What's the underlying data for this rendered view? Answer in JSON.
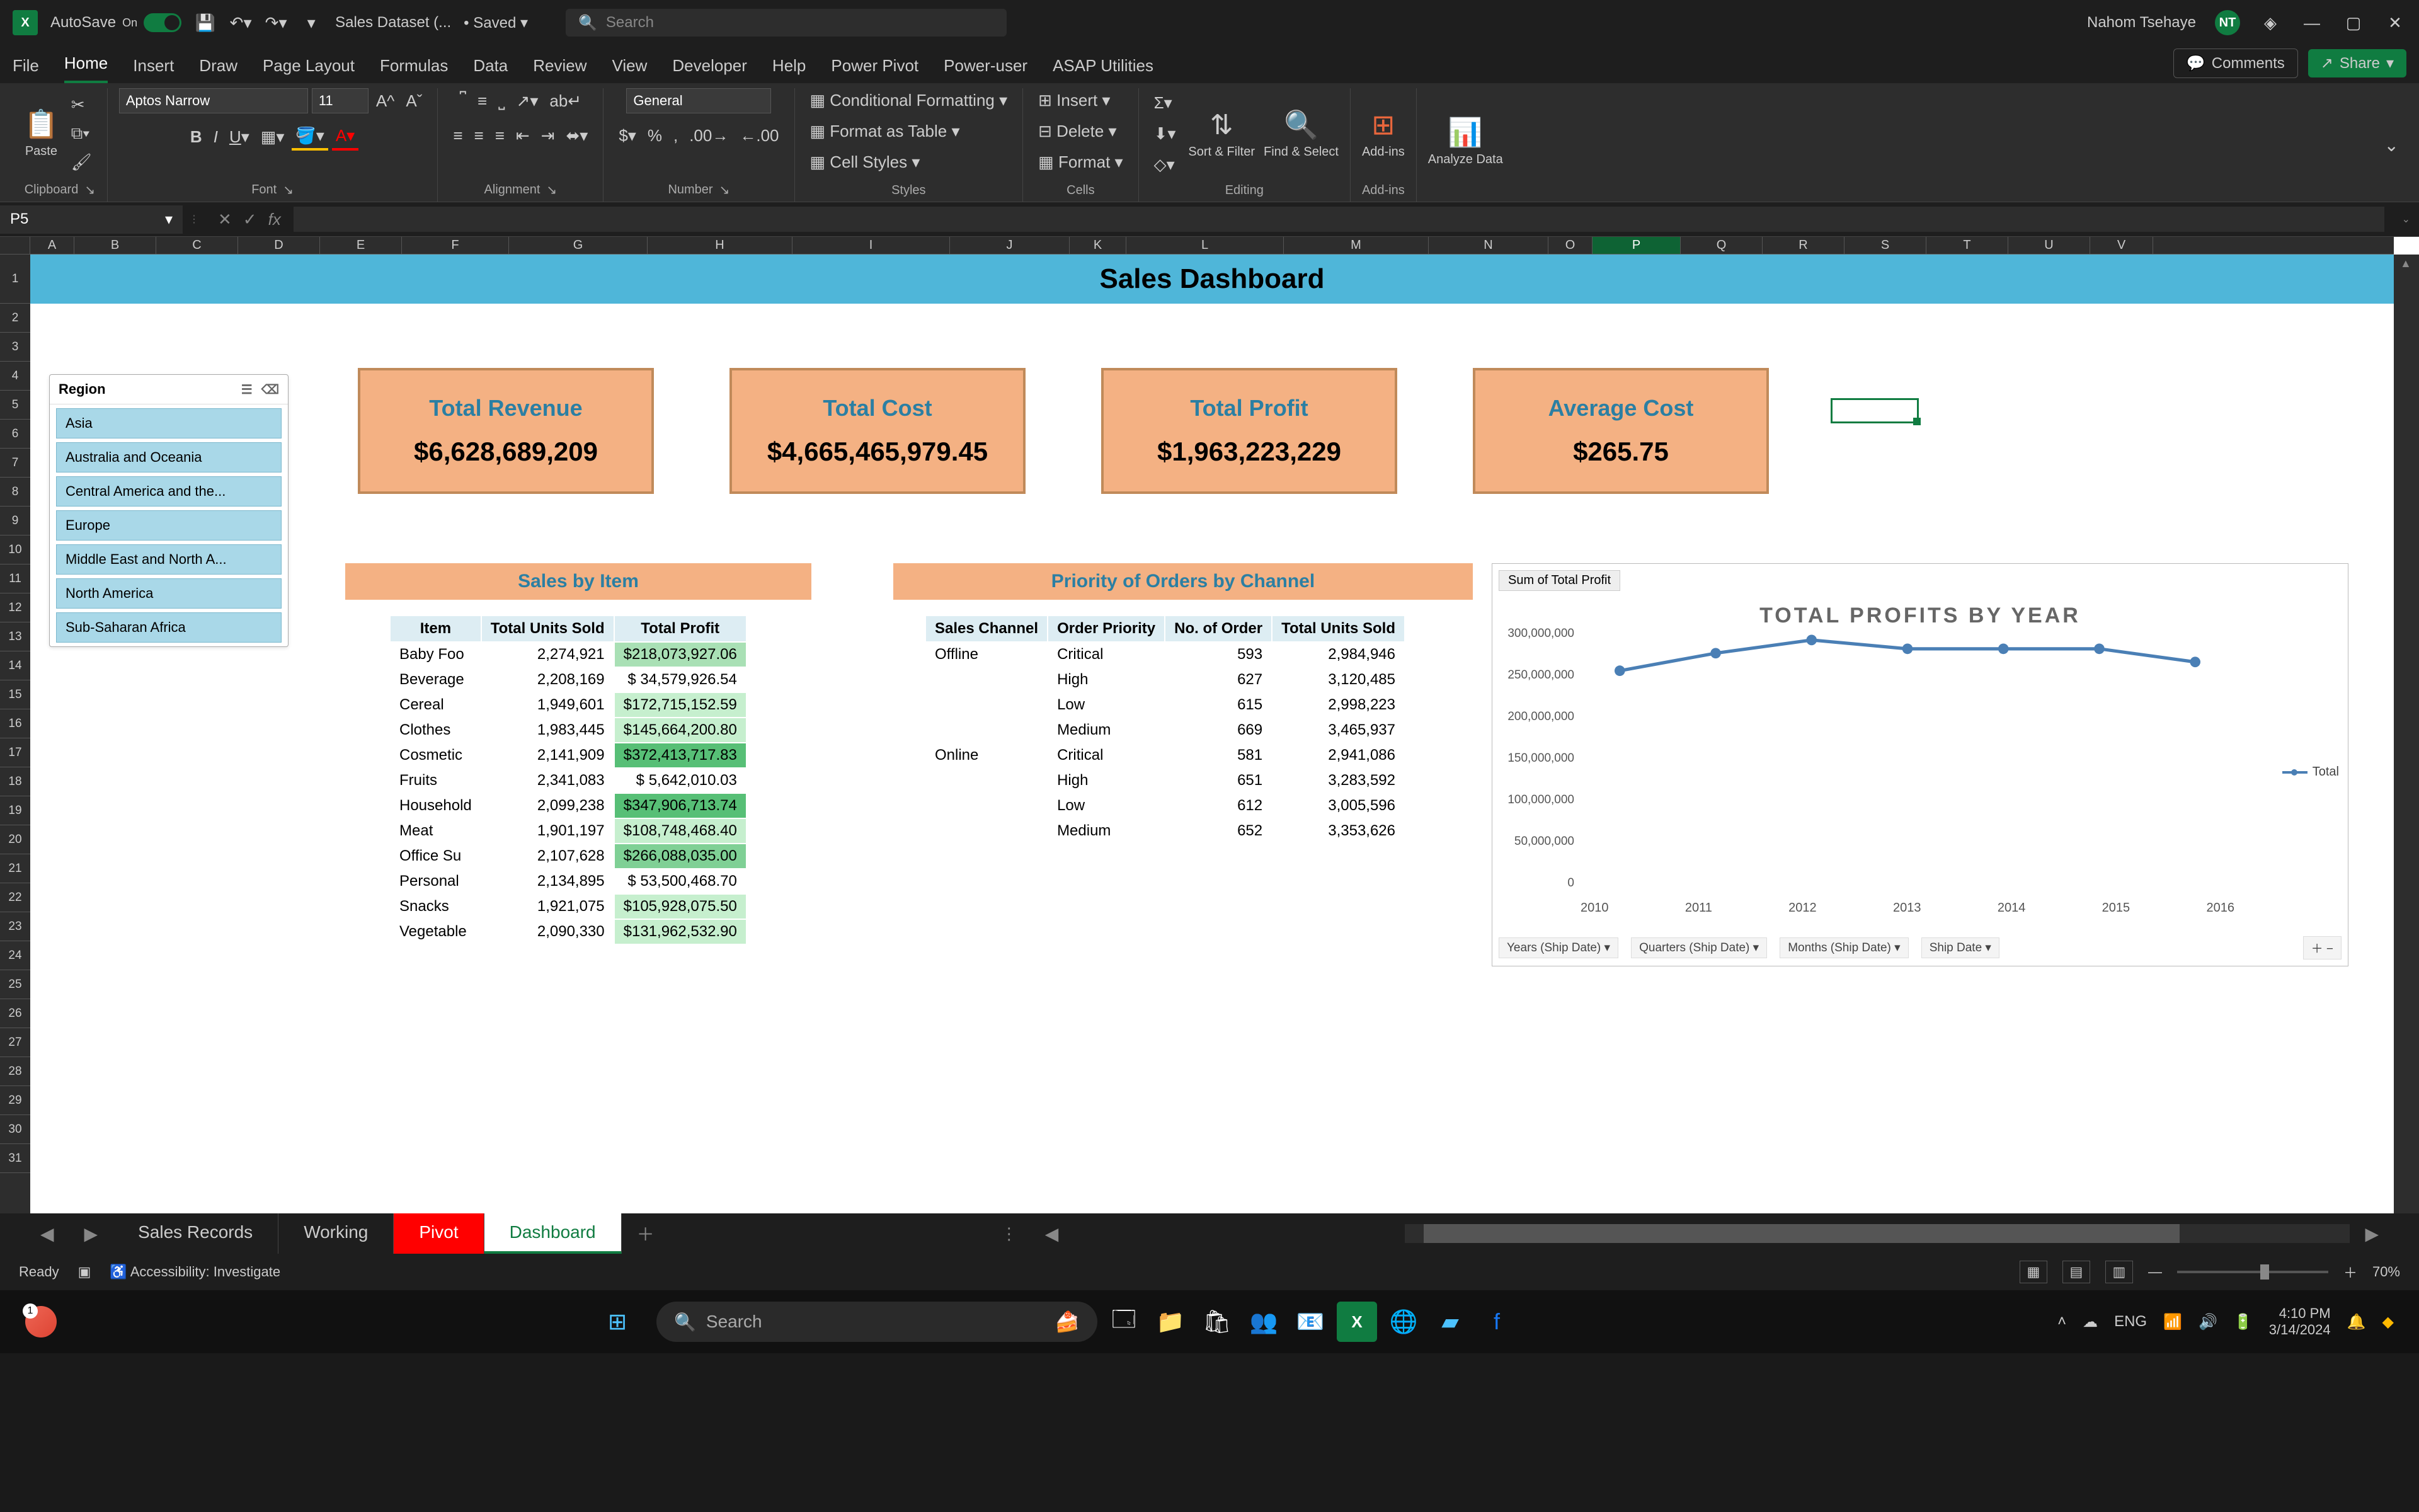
{
  "titlebar": {
    "autosave_label": "AutoSave",
    "autosave_state": "On",
    "doc_name": "Sales Dataset (...",
    "save_state": "• Saved",
    "search_placeholder": "Search",
    "user_name": "Nahom Tsehaye",
    "user_initials": "NT"
  },
  "ribbon": {
    "tabs": [
      "File",
      "Home",
      "Insert",
      "Draw",
      "Page Layout",
      "Formulas",
      "Data",
      "Review",
      "View",
      "Developer",
      "Help",
      "Power Pivot",
      "Power-user",
      "ASAP Utilities"
    ],
    "active_tab": "Home",
    "comments": "Comments",
    "share": "Share",
    "paste": "Paste",
    "font_name": "Aptos Narrow",
    "font_size": "11",
    "number_format": "General",
    "cond_format": "Conditional Formatting",
    "format_table": "Format as Table",
    "cell_styles": "Cell Styles",
    "insert": "Insert",
    "delete": "Delete",
    "format": "Format",
    "sort_filter": "Sort & Filter",
    "find_select": "Find & Select",
    "addins": "Add-ins",
    "analyze": "Analyze Data",
    "group_clipboard": "Clipboard",
    "group_font": "Font",
    "group_alignment": "Alignment",
    "group_number": "Number",
    "group_styles": "Styles",
    "group_cells": "Cells",
    "group_editing": "Editing",
    "group_addins": "Add-ins"
  },
  "namebox": {
    "ref": "P5"
  },
  "columns": [
    "A",
    "B",
    "C",
    "D",
    "E",
    "F",
    "G",
    "H",
    "I",
    "J",
    "K",
    "L",
    "M",
    "N",
    "O",
    "P",
    "Q",
    "R",
    "S",
    "T",
    "U",
    "V"
  ],
  "selected_col": "P",
  "rows": [
    "1",
    "2",
    "3",
    "4",
    "5",
    "6",
    "7",
    "8",
    "9",
    "10",
    "11",
    "12",
    "13",
    "14",
    "15",
    "16",
    "17",
    "18",
    "19",
    "20",
    "21",
    "22",
    "23",
    "24",
    "25",
    "26",
    "27",
    "28",
    "29",
    "30",
    "31"
  ],
  "dashboard": {
    "title": "Sales Dashboard",
    "slicer_title": "Region",
    "slicer_items": [
      "Asia",
      "Australia and Oceania",
      "Central America and the...",
      "Europe",
      "Middle East and North A...",
      "North America",
      "Sub-Saharan Africa"
    ],
    "kpis": [
      {
        "label": "Total Revenue",
        "value": "$6,628,689,209"
      },
      {
        "label": "Total Cost",
        "value": "$4,665,465,979.45"
      },
      {
        "label": "Total Profit",
        "value": "$1,963,223,229"
      },
      {
        "label": "Average Cost",
        "value": "$265.75"
      }
    ],
    "sect1_title": "Sales by Item",
    "sect2_title": "Priority of Orders by Channel",
    "table1_headers": [
      "Item",
      "Total Units Sold",
      "Total Profit"
    ],
    "table1": [
      {
        "item": "Baby Foo",
        "units": "2,274,921",
        "profit": "$218,073,927.06",
        "cls": "green2"
      },
      {
        "item": "Beverage",
        "units": "2,208,169",
        "profit": "$   34,579,926.54",
        "cls": ""
      },
      {
        "item": "Cereal",
        "units": "1,949,601",
        "profit": "$172,715,152.59",
        "cls": "green1"
      },
      {
        "item": "Clothes",
        "units": "1,983,445",
        "profit": "$145,664,200.80",
        "cls": "green1"
      },
      {
        "item": "Cosmetic",
        "units": "2,141,909",
        "profit": "$372,413,717.83",
        "cls": "green4"
      },
      {
        "item": "Fruits",
        "units": "2,341,083",
        "profit": "$     5,642,010.03",
        "cls": ""
      },
      {
        "item": "Household",
        "units": "2,099,238",
        "profit": "$347,906,713.74",
        "cls": "green4"
      },
      {
        "item": "Meat",
        "units": "1,901,197",
        "profit": "$108,748,468.40",
        "cls": "green1"
      },
      {
        "item": "Office Su",
        "units": "2,107,628",
        "profit": "$266,088,035.00",
        "cls": "green3"
      },
      {
        "item": "Personal",
        "units": "2,134,895",
        "profit": "$   53,500,468.70",
        "cls": ""
      },
      {
        "item": "Snacks",
        "units": "1,921,075",
        "profit": "$105,928,075.50",
        "cls": "green1"
      },
      {
        "item": "Vegetable",
        "units": "2,090,330",
        "profit": "$131,962,532.90",
        "cls": "green1"
      }
    ],
    "table2_headers": [
      "Sales Channel",
      "Order Priority",
      "No. of Order",
      "Total Units Sold"
    ],
    "table2": [
      {
        "ch": "Offline",
        "pr": "Critical",
        "no": "593",
        "units": "2,984,946"
      },
      {
        "ch": "",
        "pr": "High",
        "no": "627",
        "units": "3,120,485"
      },
      {
        "ch": "",
        "pr": "Low",
        "no": "615",
        "units": "2,998,223"
      },
      {
        "ch": "",
        "pr": "Medium",
        "no": "669",
        "units": "3,465,937"
      },
      {
        "ch": "Online",
        "pr": "Critical",
        "no": "581",
        "units": "2,941,086"
      },
      {
        "ch": "",
        "pr": "High",
        "no": "651",
        "units": "3,283,592"
      },
      {
        "ch": "",
        "pr": "Low",
        "no": "612",
        "units": "3,005,596"
      },
      {
        "ch": "",
        "pr": "Medium",
        "no": "652",
        "units": "3,353,626"
      }
    ]
  },
  "chart_data": {
    "type": "line",
    "title": "TOTAL PROFITS BY YEAR",
    "field_label": "Sum of Total Profit",
    "legend": "Total",
    "ylabel": "",
    "xlabel": "",
    "ylim": [
      0,
      300000000
    ],
    "yticks": [
      "300,000,000",
      "250,000,000",
      "200,000,000",
      "150,000,000",
      "100,000,000",
      "50,000,000",
      "0"
    ],
    "categories": [
      "2010",
      "2011",
      "2012",
      "2013",
      "2014",
      "2015",
      "2016"
    ],
    "series": [
      {
        "name": "Total",
        "values": [
          250000000,
          270000000,
          285000000,
          275000000,
          275000000,
          275000000,
          260000000
        ]
      }
    ],
    "filters": [
      "Years (Ship Date)",
      "Quarters (Ship Date)",
      "Months (Ship Date)",
      "Ship Date"
    ]
  },
  "sheets": {
    "tabs": [
      "Sales Records",
      "Working",
      "Pivot",
      "Dashboard"
    ],
    "active": "Dashboard",
    "red": "Pivot"
  },
  "statusbar": {
    "ready": "Ready",
    "accessibility": "Accessibility: Investigate",
    "zoom": "70%"
  },
  "taskbar": {
    "search": "Search",
    "time": "4:10 PM",
    "date": "3/14/2024"
  }
}
